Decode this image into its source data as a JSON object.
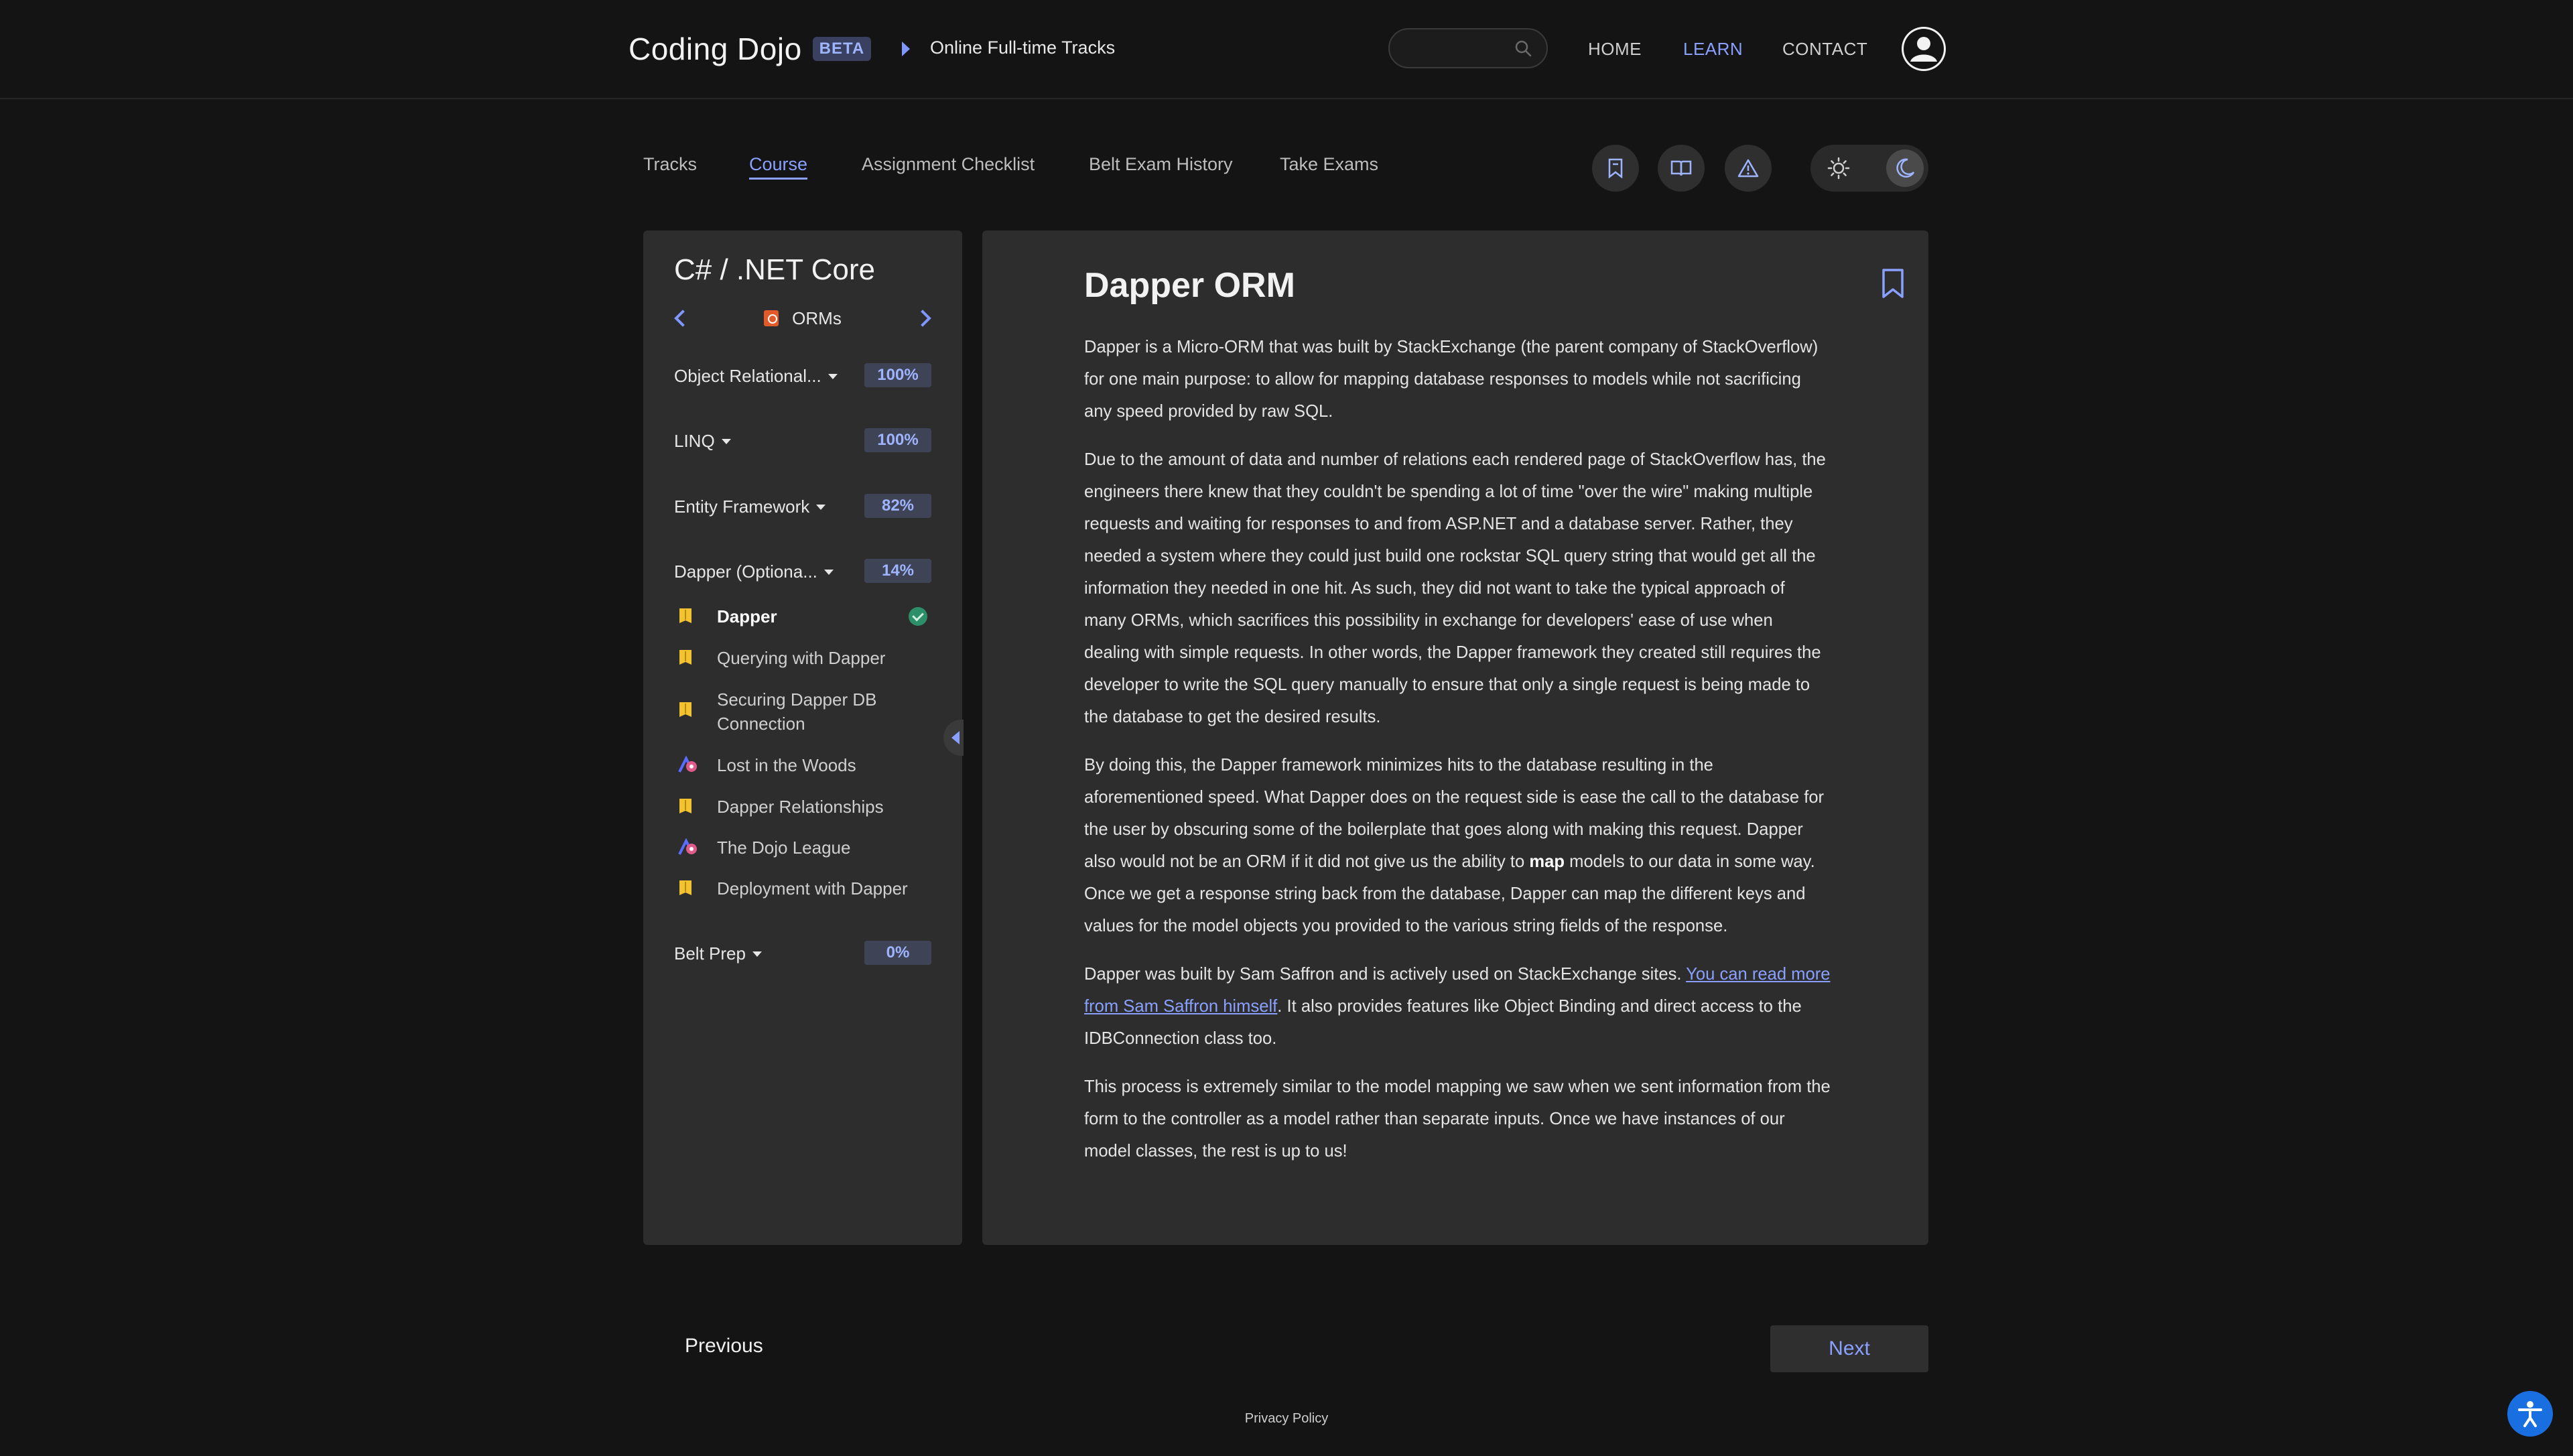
{
  "header": {
    "brand": "Coding Dojo",
    "beta": "BETA",
    "breadcrumb": "Online Full-time Tracks",
    "search_placeholder": "",
    "nav": {
      "home": "HOME",
      "learn": "LEARN",
      "contact": "CONTACT"
    }
  },
  "tabs": [
    "Tracks",
    "Course",
    "Assignment Checklist",
    "Belt Exam History",
    "Take Exams"
  ],
  "active_tab": "Course",
  "sidebar": {
    "title": "C# / .NET Core",
    "unit": "ORMs",
    "sections": [
      {
        "label": "Object Relational...",
        "pct": "100%"
      },
      {
        "label": "LINQ",
        "pct": "100%"
      },
      {
        "label": "Entity Framework",
        "pct": "82%"
      },
      {
        "label": "Dapper (Optiona...",
        "pct": "14%"
      }
    ],
    "lessons": [
      {
        "label": "Dapper",
        "type": "reading",
        "current": true,
        "done": true
      },
      {
        "label": "Querying with Dapper",
        "type": "reading"
      },
      {
        "label": "Securing Dapper DB Connection",
        "type": "reading"
      },
      {
        "label": "Lost in the Woods",
        "type": "assignment"
      },
      {
        "label": "Dapper Relationships",
        "type": "reading"
      },
      {
        "label": "The Dojo League",
        "type": "assignment"
      },
      {
        "label": "Deployment with Dapper",
        "type": "reading"
      }
    ],
    "last_section": {
      "label": "Belt Prep",
      "pct": "0%"
    }
  },
  "content": {
    "title": "Dapper ORM",
    "p1": "Dapper is a Micro-ORM that was built by StackExchange (the parent company of StackOverflow) for one main purpose: to allow for mapping database responses to models while not sacrificing any speed provided by raw SQL.",
    "p2": "Due to the amount of data and number of relations each rendered page of StackOverflow has, the engineers there knew that they couldn't be spending a lot of time \"over the wire\" making multiple requests and waiting for responses to and from ASP.NET and a database server. Rather, they needed a system where they could just build one rockstar SQL query string that would get all the information they needed in one hit. As such, they did not want to take the typical approach of many ORMs, which sacrifices this possibility in exchange for developers' ease of use when dealing with simple requests. In other words, the Dapper framework they created still requires the developer to write the SQL query manually to ensure that only a single request is being made to the database to get the desired results.",
    "p3_a": "By doing this, the Dapper framework minimizes hits to the database resulting in the aforementioned speed. What Dapper does on the request side is ease the call to the database for the user by obscuring some of the boilerplate that goes along with making this request. Dapper also would not be an ORM if it did not give us the ability to ",
    "p3_bold": "map",
    "p3_b": " models to our data in some way. Once we get a response string back from the database, Dapper can map the different keys and values for the model objects you provided to the various string fields of the response.",
    "p4_a": "Dapper was built by Sam Saffron and is actively used on StackExchange sites. ",
    "p4_link": "You can read more from Sam Saffron himself",
    "p4_b": ". It also provides features like Object Binding and direct access to the IDBConnection class too.",
    "p5": "This process is extremely similar to the model mapping we saw when we sent information from the form to the controller as a model rather than separate inputs. Once we have instances of our model classes, the rest is up to us!"
  },
  "footer": {
    "previous": "Previous",
    "next": "Next",
    "privacy": "Privacy Policy"
  },
  "colors": {
    "accent": "#8aa0ff",
    "background": "#141414",
    "panel": "#2d2d2d",
    "success": "#2c8f6a",
    "reading_icon": "#f2c230",
    "assignment_icon": "#5b6cff"
  }
}
